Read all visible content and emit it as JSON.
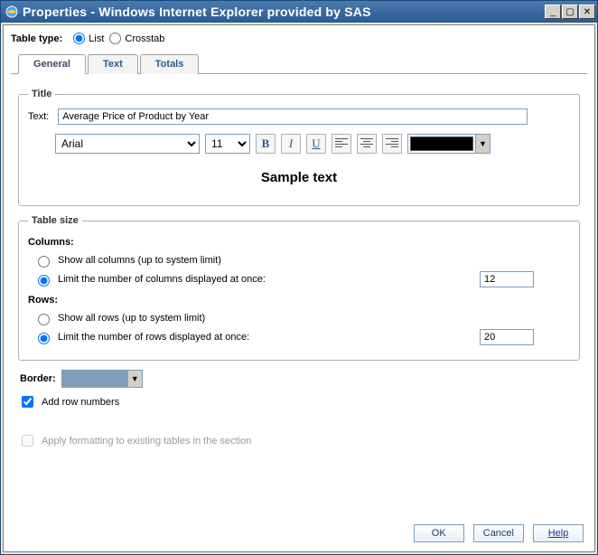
{
  "window": {
    "title": "Properties - Windows Internet Explorer provided by SAS"
  },
  "table_type": {
    "label": "Table type:",
    "list_label": "List",
    "crosstab_label": "Crosstab",
    "selected": "list"
  },
  "tabs": {
    "general": "General",
    "text": "Text",
    "totals": "Totals"
  },
  "title_group": {
    "legend": "Title",
    "text_label": "Text:",
    "text_value": "Average Price of Product by Year",
    "font_family": "Arial",
    "font_size": "11",
    "sample": "Sample text",
    "color": "#000000"
  },
  "table_size": {
    "legend": "Table size",
    "columns_label": "Columns:",
    "col_all": "Show all columns (up to system limit)",
    "col_limit": "Limit the number of columns displayed at once:",
    "col_limit_value": "12",
    "rows_label": "Rows:",
    "row_all": "Show all rows (up to system limit)",
    "row_limit": "Limit the number of rows displayed at once:",
    "row_limit_value": "20"
  },
  "border": {
    "label": "Border:"
  },
  "add_row_numbers": {
    "label": "Add row numbers",
    "checked": true
  },
  "apply_formatting": {
    "label": "Apply formatting to existing tables in the section",
    "checked": false,
    "disabled": true
  },
  "buttons": {
    "ok": "OK",
    "cancel": "Cancel",
    "help": "Help"
  }
}
